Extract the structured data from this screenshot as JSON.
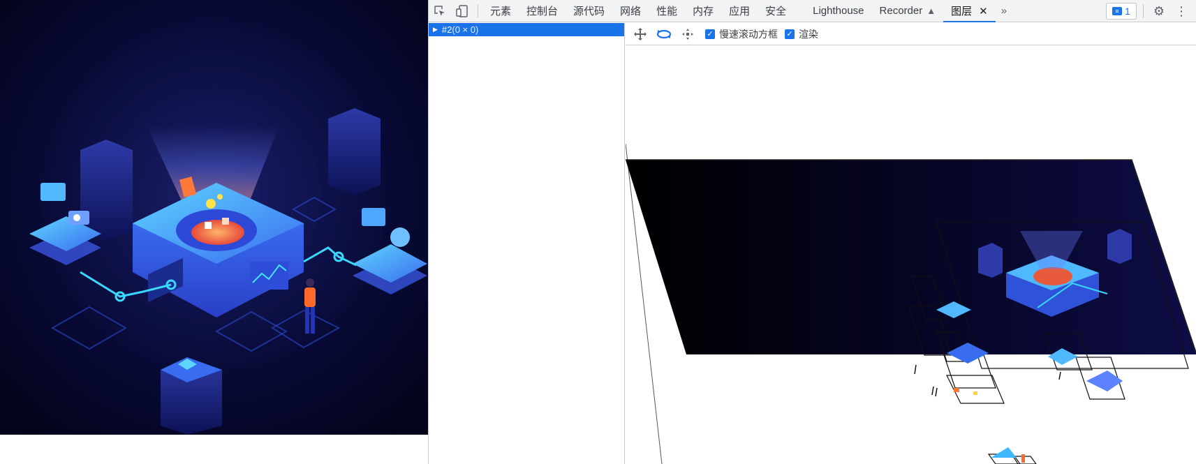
{
  "toolbar": {
    "inspect_icon": "inspect-element-icon",
    "device_icon": "device-toolbar-icon",
    "tabs": [
      {
        "label": "元素"
      },
      {
        "label": "控制台"
      },
      {
        "label": "源代码"
      },
      {
        "label": "网络"
      },
      {
        "label": "性能"
      },
      {
        "label": "内存"
      },
      {
        "label": "应用"
      },
      {
        "label": "安全"
      },
      {
        "label": "Lighthouse"
      },
      {
        "label": "Recorder"
      },
      {
        "label": "图层"
      }
    ],
    "issues_count": "1"
  },
  "layer_tree": {
    "root_label": "#2",
    "root_size": "(0 × 0)"
  },
  "layers_toolbar": {
    "slow_scroll_label": "慢速滚动方框",
    "paints_label": "渲染"
  },
  "colors": {
    "accent": "#1a73e8",
    "page_bg_dark": "#050424",
    "glow_cyan": "#3ad7ff"
  }
}
